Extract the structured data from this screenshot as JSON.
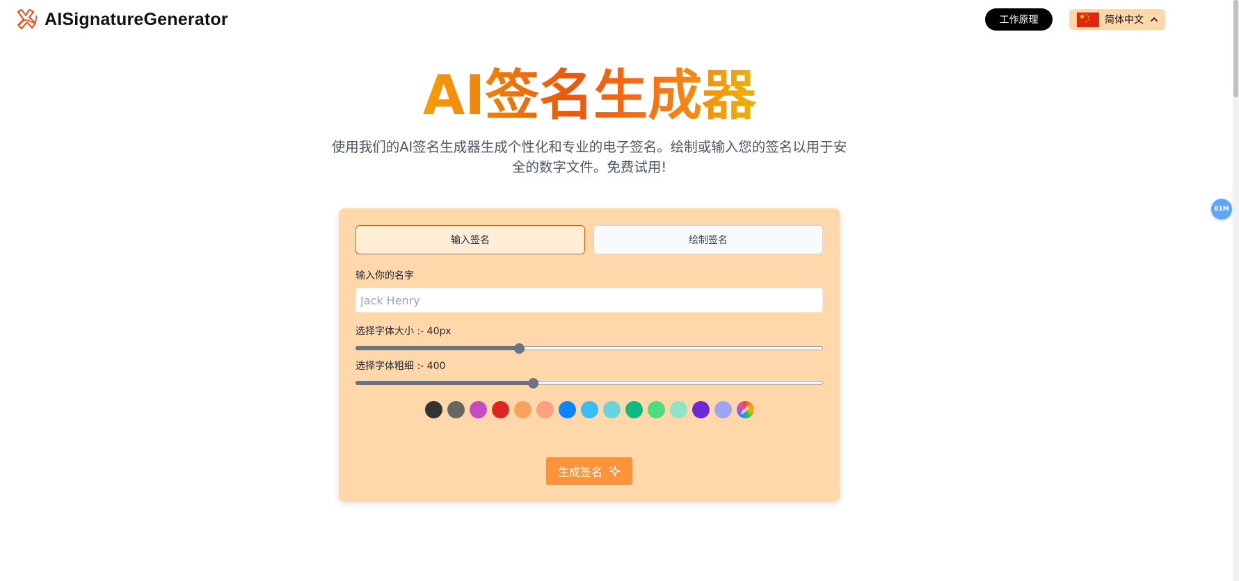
{
  "header": {
    "brand": "AISignatureGenerator",
    "how_it_works": "工作原理",
    "language": "简体中文"
  },
  "hero": {
    "title": "AI签名生成器",
    "subtitle_line1": "使用我们的AI签名生成器生成个性化和专业的电子签名。绘制或输入您的签名以用于安",
    "subtitle_line2": "全的数字文件。免费试用!"
  },
  "card": {
    "tabs": [
      {
        "label": "输入签名",
        "active": true
      },
      {
        "label": "绘制签名",
        "active": false
      }
    ],
    "name_label": "输入你的名字",
    "name_placeholder": "Jack Henry",
    "name_value": "",
    "size_label": "选择字体大小 :- 40px",
    "size_value": 40,
    "size_fraction": 0.35,
    "weight_label": "选择字体粗细 :- 400",
    "weight_value": 400,
    "weight_fraction": 0.38,
    "colors": [
      "#333333",
      "#666666",
      "#c34bc3",
      "#e02424",
      "#fba15c",
      "#fda27e",
      "#0a84ff",
      "#38bdf8",
      "#67d5db",
      "#10b981",
      "#4ade80",
      "#8ce5c4",
      "#6d28d9",
      "#9ca6f0"
    ],
    "generate_label": "生成签名"
  },
  "float_badge": "81M",
  "colors": {
    "accent": "#ea580c",
    "card_bg": "#fed7aa",
    "button": "#fb923c"
  }
}
